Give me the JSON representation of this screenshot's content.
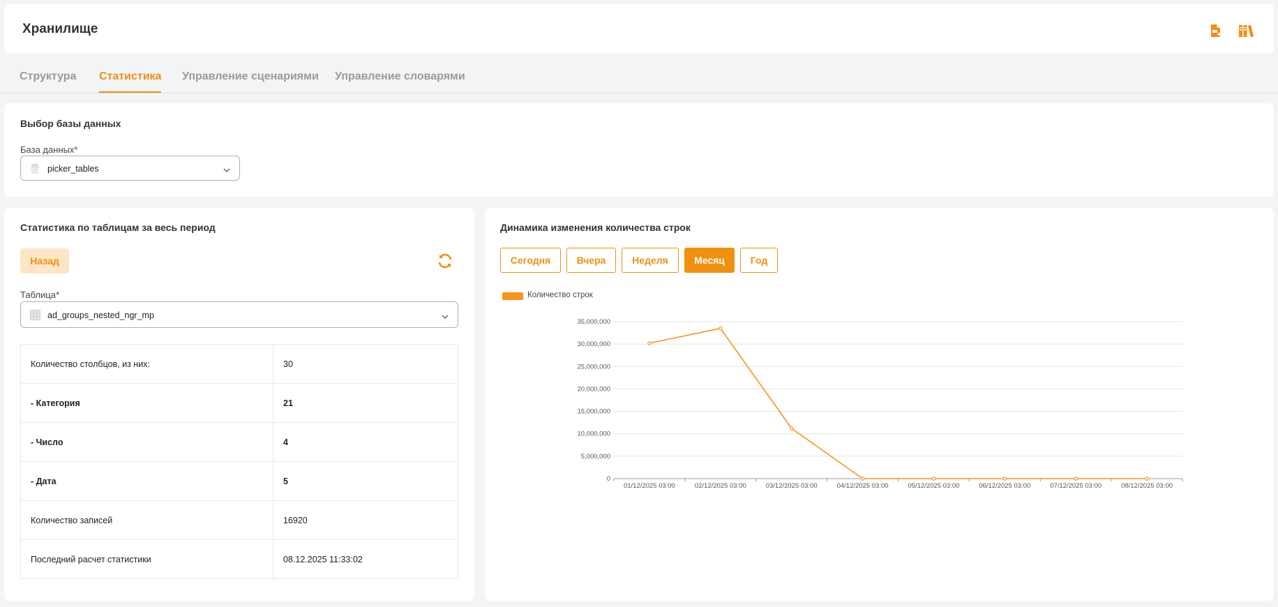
{
  "header": {
    "title": "Хранилище",
    "icons": [
      "file-export-icon",
      "library-books-icon"
    ]
  },
  "tabs": [
    {
      "label": "Структура",
      "active": false
    },
    {
      "label": "Статистика",
      "active": true
    },
    {
      "label": "Управление сценариями",
      "active": false
    },
    {
      "label": "Управление словарями",
      "active": false
    }
  ],
  "db_select": {
    "section_title": "Выбор базы данных",
    "label": "База данных*",
    "value": "picker_tables"
  },
  "stats": {
    "section_title": "Статистика по таблицам за весь период",
    "back_label": "Назад",
    "table_label": "Таблица*",
    "table_value": "ad_groups_nested_ngr_mp",
    "rows": [
      {
        "name": "Количество столбцов, из них:",
        "value": "30",
        "bold": false
      },
      {
        "name": "- Категория",
        "value": "21",
        "bold": true
      },
      {
        "name": "- Число",
        "value": "4",
        "bold": true
      },
      {
        "name": "- Дата",
        "value": "5",
        "bold": true
      },
      {
        "name": "Количество записей",
        "value": "16920",
        "bold": false
      },
      {
        "name": "Последний расчет статистики",
        "value": "08.12.2025 11:33:02",
        "bold": false
      }
    ]
  },
  "chart_panel": {
    "section_title": "Динамика изменения количества строк",
    "periods": [
      {
        "label": "Сегодня",
        "active": false
      },
      {
        "label": "Вчера",
        "active": false
      },
      {
        "label": "Неделя",
        "active": false
      },
      {
        "label": "Месяц",
        "active": true
      },
      {
        "label": "Год",
        "active": false
      }
    ]
  },
  "colors": {
    "accent": "#f18f0f",
    "accent_light": "#fde6c6",
    "line": "#f7931e"
  },
  "chart_data": {
    "type": "line",
    "title": "",
    "xlabel": "",
    "ylabel": "",
    "categories": [
      "01/12/2025 03:00",
      "02/12/2025 03:00",
      "03/12/2025 03:00",
      "04/12/2025 03:00",
      "05/12/2025 03:00",
      "06/12/2025 03:00",
      "07/12/2025 03:00",
      "08/12/2025 03:00"
    ],
    "series": [
      {
        "name": "Количество строк",
        "values": [
          30200000,
          33500000,
          11200000,
          0,
          0,
          0,
          0,
          0
        ]
      }
    ],
    "ylim": [
      0,
      35000000
    ],
    "yticks": [
      0,
      5000000,
      10000000,
      15000000,
      20000000,
      25000000,
      30000000,
      35000000
    ],
    "ytick_labels": [
      "0",
      "5,000,000",
      "10,000,000",
      "15,000,000",
      "20,000,000",
      "25,000,000",
      "30,000,000",
      "35,000,000"
    ],
    "grid": true,
    "legend": "top-left"
  }
}
